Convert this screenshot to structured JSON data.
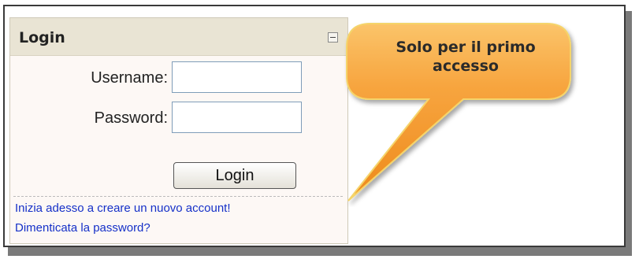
{
  "login_block": {
    "title": "Login",
    "username_label": "Username:",
    "username_value": "",
    "password_label": "Password:",
    "password_value": "",
    "login_button": "Login",
    "create_account_link": "Inizia adesso a creare un nuovo account!",
    "forgot_password_link": "Dimenticata la password?"
  },
  "callout": {
    "text": "Solo per il primo accesso",
    "fill_color": "#f6a13b",
    "border_color": "#f5d46a"
  },
  "colors": {
    "header_bg": "#e9e4d4",
    "block_bg": "#fdf8f5",
    "link": "#1530c8"
  },
  "icons": {
    "collapse": "minus-box-icon"
  }
}
